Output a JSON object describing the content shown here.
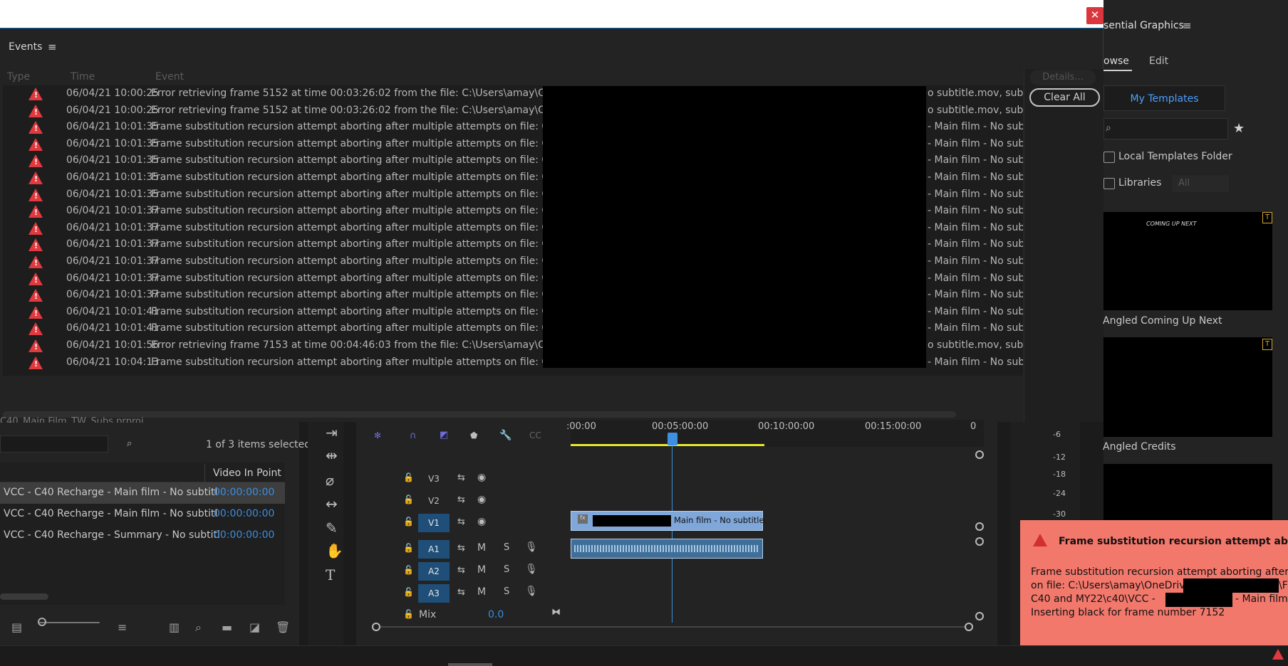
{
  "events_dialog": {
    "title": "Events",
    "columns": {
      "type": "Type",
      "time": "Time",
      "event": "Event"
    },
    "details_label": "Details...",
    "clear_all_label": "Clear All",
    "rows": [
      {
        "time": "06/04/21 10:00:25",
        "msg": "Error retrieving frame 5152 at time 00:03:26:02 from the file: C:\\Users\\amay\\OneDrive -",
        "tail": "o subtitle.mov, substit"
      },
      {
        "time": "06/04/21 10:00:25",
        "msg": "Error retrieving frame 5152 at time 00:03:26:02 from the file: C:\\Users\\amay\\OneDrive -",
        "tail": "o subtitle.mov, substit"
      },
      {
        "time": "06/04/21 10:01:35",
        "msg": "Frame substitution recursion attempt aborting after multiple attempts on file: C:\\Users\\am",
        "tail": "- Main film - No subtitl"
      },
      {
        "time": "06/04/21 10:01:35",
        "msg": "Frame substitution recursion attempt aborting after multiple attempts on file: C:\\Users\\am",
        "tail": "- Main film - No subtitl"
      },
      {
        "time": "06/04/21 10:01:35",
        "msg": "Frame substitution recursion attempt aborting after multiple attempts on file: C:\\Users\\am",
        "tail": "- Main film - No subtitl"
      },
      {
        "time": "06/04/21 10:01:35",
        "msg": "Frame substitution recursion attempt aborting after multiple attempts on file: C:\\Users\\am",
        "tail": "- Main film - No subtitl"
      },
      {
        "time": "06/04/21 10:01:35",
        "msg": "Frame substitution recursion attempt aborting after multiple attempts on file: C:\\Users\\am",
        "tail": "- Main film - No subtitl"
      },
      {
        "time": "06/04/21 10:01:37",
        "msg": "Frame substitution recursion attempt aborting after multiple attempts on file: C:\\Users\\am",
        "tail": "- Main film - No subtitl"
      },
      {
        "time": "06/04/21 10:01:37",
        "msg": "Frame substitution recursion attempt aborting after multiple attempts on file: C:\\Users\\am",
        "tail": "- Main film - No subtitl"
      },
      {
        "time": "06/04/21 10:01:37",
        "msg": "Frame substitution recursion attempt aborting after multiple attempts on file: C:\\Users\\am",
        "tail": "- Main film - No subtitl"
      },
      {
        "time": "06/04/21 10:01:37",
        "msg": "Frame substitution recursion attempt aborting after multiple attempts on file: C:\\Users\\am",
        "tail": "- Main film - No subtitl"
      },
      {
        "time": "06/04/21 10:01:37",
        "msg": "Frame substitution recursion attempt aborting after multiple attempts on file: C:\\Users\\am",
        "tail": "- Main film - No subtitl"
      },
      {
        "time": "06/04/21 10:01:37",
        "msg": "Frame substitution recursion attempt aborting after multiple attempts on file: C:\\Users\\am",
        "tail": "- Main film - No subtitl"
      },
      {
        "time": "06/04/21 10:01:41",
        "msg": "Frame substitution recursion attempt aborting after multiple attempts on file: C:\\Users\\am",
        "tail": "- Main film - No subtitl"
      },
      {
        "time": "06/04/21 10:01:41",
        "msg": "Frame substitution recursion attempt aborting after multiple attempts on file: C:\\Users\\am",
        "tail": "- Main film - No subtitl"
      },
      {
        "time": "06/04/21 10:01:56",
        "msg": "Error retrieving frame 7153 at time 00:04:46:03 from the file: C:\\Users\\amay\\OneDrive -",
        "tail": "o subtitle.mov, substit"
      },
      {
        "time": "06/04/21 10:04:13",
        "msg": "Frame substitution recursion attempt aborting after multiple attempts on file: C:\\Users\\am",
        "tail": "- Main film - No subtitl"
      }
    ]
  },
  "essential_graphics": {
    "title": "sential Graphics",
    "tab_browse": "owse",
    "tab_edit": "Edit",
    "my_templates": "My Templates",
    "local_templates": "Local Templates Folder",
    "libraries": "Libraries",
    "libraries_select": "All",
    "templates": [
      {
        "label": "Angled Coming Up Next",
        "thumb_text": "COMING UP NEXT"
      },
      {
        "label": "Angled Credits"
      }
    ]
  },
  "project": {
    "file_name": "C40_Main Film_TW_Subs.prproj",
    "selection_count": "1 of 3 items selected",
    "column_video_in_point": "Video In Point",
    "items": [
      {
        "name": "VCC - C40 Recharge - Main film - No subtitl",
        "in_point": "00:00:00:00"
      },
      {
        "name": "VCC - C40 Recharge - Main film - No subtitl",
        "in_point": "00:00:00:00"
      },
      {
        "name": "VCC - C40 Recharge - Summary - No subtitl",
        "in_point": "00:00:00:00"
      }
    ]
  },
  "timeline": {
    "ruler": [
      ":00:00",
      "00:05:00:00",
      "00:10:00:00",
      "00:15:00:00",
      "0"
    ],
    "tracks_video": [
      "V3",
      "V2",
      "V1"
    ],
    "tracks_audio": [
      "A1",
      "A2",
      "A3"
    ],
    "audio_m": "M",
    "audio_s": "S",
    "mix_label": "Mix",
    "mix_value": "0.0",
    "clip_v1_label": "Main film - No subtitle."
  },
  "meter": {
    "ticks": [
      "-6",
      "-12",
      "-18",
      "-24",
      "-30"
    ]
  },
  "toast": {
    "title": "Frame substitution recursion attempt aborting afte",
    "line1": "Frame substitution recursion attempt aborting after multip",
    "line2_a": "on file: C:\\Users\\amay\\OneDrive -",
    "line2_b": "\\F",
    "line3_a": "C40 and MY22\\c40\\VCC -",
    "line3_b": "- Main film - No su",
    "line4": " Inserting black for frame number 7152"
  },
  "colors": {
    "accent_blue": "#3a8dde",
    "error_red": "#e0393e",
    "toast_bg": "#f3786c"
  }
}
